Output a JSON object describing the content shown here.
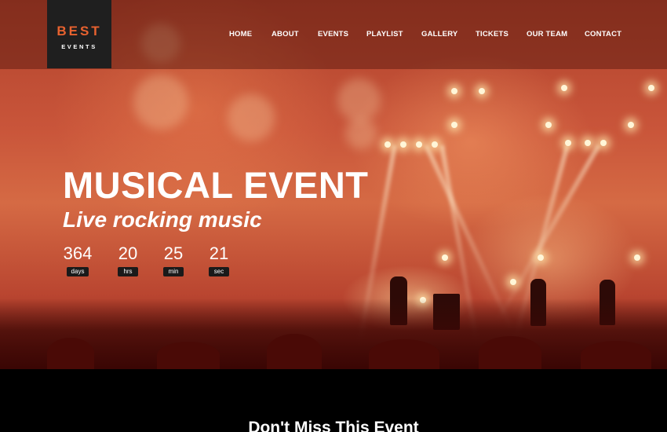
{
  "logo": {
    "line1": "BEST",
    "line2": "EVENTS"
  },
  "nav": {
    "items": [
      {
        "label": "HOME"
      },
      {
        "label": "ABOUT"
      },
      {
        "label": "EVENTS"
      },
      {
        "label": "PLAYLIST"
      },
      {
        "label": "GALLERY"
      },
      {
        "label": "TICKETS"
      },
      {
        "label": "OUR TEAM"
      },
      {
        "label": "CONTACT"
      }
    ]
  },
  "hero": {
    "title": "MUSICAL EVENT",
    "subtitle": "Live rocking music",
    "countdown": [
      {
        "value": "364",
        "label": "days"
      },
      {
        "value": "20",
        "label": "hrs"
      },
      {
        "value": "25",
        "label": "min"
      },
      {
        "value": "21",
        "label": "sec"
      }
    ]
  },
  "section": {
    "title": "Don't Miss This Event"
  },
  "colors": {
    "accent": "#e8622f",
    "logo_bg": "#1f1f1f",
    "hero_tint": "#c9553a"
  }
}
